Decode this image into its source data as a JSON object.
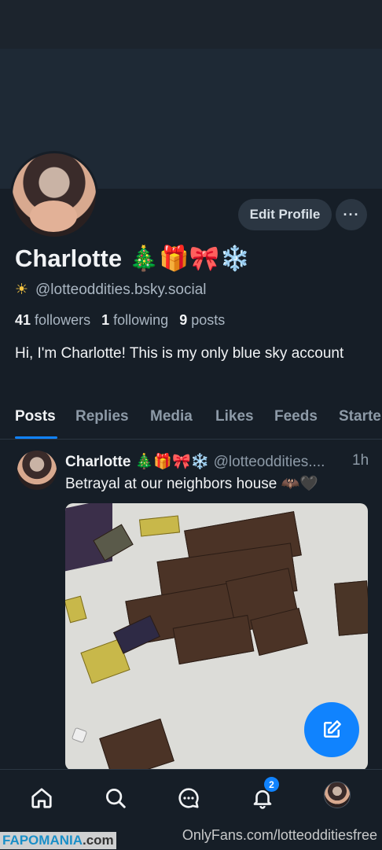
{
  "profile": {
    "name": "Charlotte 🎄🎁🎀❄️",
    "handle_emoji": "☀",
    "handle": "@lotteoddities.bsky.social",
    "followers_count": "41",
    "followers_label": "followers",
    "following_count": "1",
    "following_label": "following",
    "posts_count": "9",
    "posts_label": "posts",
    "bio": "Hi, I'm Charlotte! This is my only blue sky account"
  },
  "actions": {
    "edit_profile": "Edit Profile",
    "more": "···"
  },
  "tabs": [
    {
      "label": "Posts",
      "active": true
    },
    {
      "label": "Replies"
    },
    {
      "label": "Media"
    },
    {
      "label": "Likes"
    },
    {
      "label": "Feeds"
    },
    {
      "label": "Starter"
    }
  ],
  "post": {
    "author": "Charlotte 🎄🎁🎀❄️",
    "handle": "@lotteoddities....",
    "time": "1h",
    "text": "Betrayal at our neighbors house 🦇🖤"
  },
  "nav": {
    "notifications_badge": "2",
    "icons": [
      "home-icon",
      "search-icon",
      "chat-icon",
      "bell-icon",
      "profile-avatar"
    ]
  },
  "watermark": {
    "left_brand": "FAPOMANIA",
    "left_suffix": ".com",
    "right": "OnlyFans.com/lotteodditiesfree"
  },
  "colors": {
    "background": "#161e27",
    "accent": "#1083fe",
    "button": "#2b3642"
  }
}
